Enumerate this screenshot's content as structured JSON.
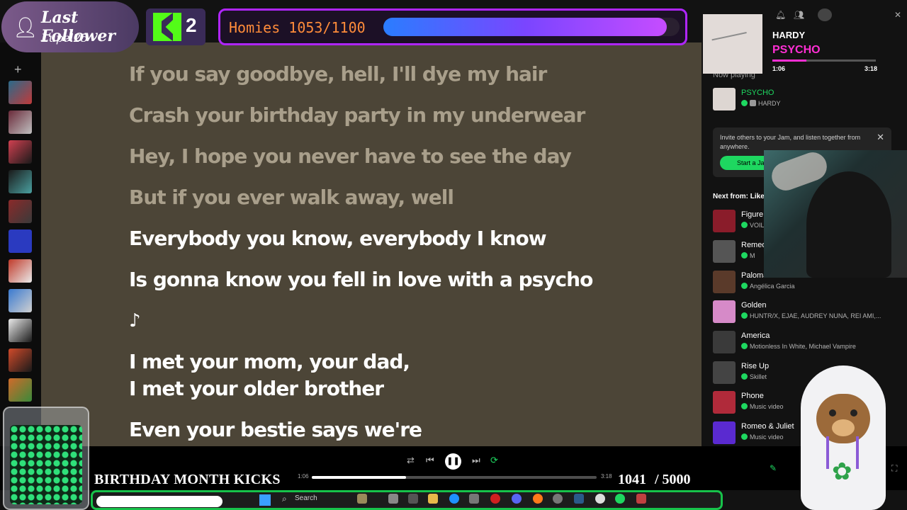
{
  "follower": {
    "title": "Last Follower",
    "name": "Lupel25"
  },
  "kick": {
    "count": "2"
  },
  "goal": {
    "label": "Homies 1053/1100",
    "current": 1053,
    "target": 1100
  },
  "now_playing_widget": {
    "artist": "HARDY",
    "title": "PSYCHO",
    "elapsed": "1:06",
    "duration": "3:18",
    "progress": 0.33
  },
  "lyrics": [
    {
      "text": "If you say goodbye, hell, I'll dye my hair",
      "active": false
    },
    {
      "text": "Crash your birthday party in my underwear",
      "active": false
    },
    {
      "text": "Hey, I hope you never have to see the day",
      "active": false
    },
    {
      "text": "But if you ever walk away, well",
      "active": false
    },
    {
      "text": "Everybody you know, everybody I know",
      "active": true
    },
    {
      "text": "Is gonna know you fell in love with a psycho",
      "active": true
    },
    {
      "text": "♪",
      "active": true
    },
    {
      "text": "I met your mom, your dad,",
      "active": true
    },
    {
      "text": "I met your older brother",
      "active": true
    },
    {
      "text": "Even your bestie says we're",
      "active": true
    }
  ],
  "sidebar": {
    "now_playing_label": "Now playing",
    "current_track": {
      "title": "PSYCHO",
      "artist": "HARDY",
      "badge": "E"
    },
    "jam": {
      "text": "Invite others to your Jam, and listen together from anywhere.",
      "button": "Start a Ja"
    },
    "next_label": "Next from: Like",
    "queue": [
      {
        "title": "Figure",
        "artist": "VOIL",
        "color": "#8a1c2a"
      },
      {
        "title": "Remed",
        "artist": "M",
        "color": "#555555"
      },
      {
        "title": "Paloma",
        "artist": "Angélica Garcia",
        "color": "#5a3a2a"
      },
      {
        "title": "Golden",
        "artist": "HUNTR/X, EJAE, AUDREY NUNA, REI AMI,...",
        "color": "#d68ac8"
      },
      {
        "title": "America",
        "artist": "Motionless In White, Michael Vampire",
        "color": "#3a3a3a"
      },
      {
        "title": "Rise Up",
        "artist": "Skillet",
        "color": "#444444"
      },
      {
        "title": "Phone",
        "artist": "Music video",
        "color": "#b02a3a"
      },
      {
        "title": "Romeo & Juliet",
        "artist": "Music video",
        "color": "#5a2ad0"
      }
    ]
  },
  "player": {
    "elapsed": "1:06",
    "duration": "3:18",
    "progress": 0.33
  },
  "banner": {
    "text": "BIRTHDAY MONTH KICKS",
    "current": "1041",
    "goal": "/ 5000"
  },
  "taskbar": {
    "search": "Search"
  },
  "colors": {
    "spotify_green": "#1ed760",
    "lyrics_bg": "#4c4537",
    "goal_border": "#b026ff",
    "accent_pink": "#ff2fd4"
  }
}
